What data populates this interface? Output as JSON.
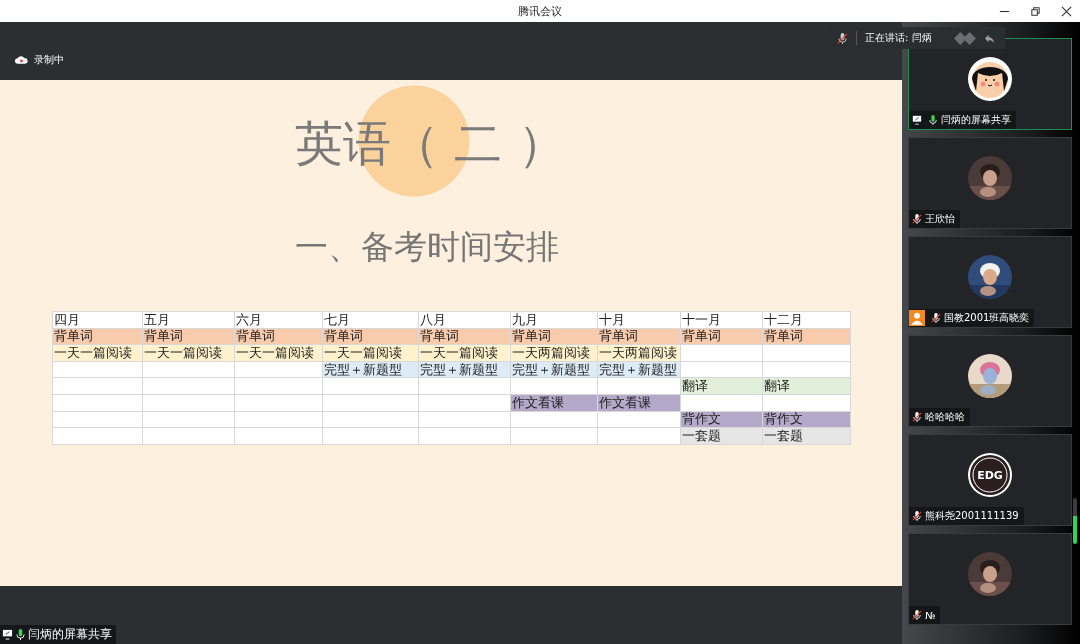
{
  "window": {
    "title": "腾讯会议"
  },
  "recording": {
    "label": "录制中"
  },
  "speaking": {
    "label": "正在讲话: 闫炳"
  },
  "slide": {
    "title": "英语（ 二 ）",
    "subtitle": "一、备考时间安排",
    "table": {
      "columns": [
        "四月",
        "五月",
        "六月",
        "七月",
        "八月",
        "九月",
        "十月",
        "十一月",
        "十二月"
      ],
      "rows": [
        [
          {
            "text": "背单词",
            "color": "#f8cbad"
          },
          {
            "text": "背单词",
            "color": "#f8cbad"
          },
          {
            "text": "背单词",
            "color": "#f8cbad"
          },
          {
            "text": "背单词",
            "color": "#f8cbad"
          },
          {
            "text": "背单词",
            "color": "#f8cbad"
          },
          {
            "text": "背单词",
            "color": "#f8cbad"
          },
          {
            "text": "背单词",
            "color": "#f8cbad"
          },
          {
            "text": "背单词",
            "color": "#f8cbad"
          },
          {
            "text": "背单词",
            "color": "#f8cbad"
          }
        ],
        [
          {
            "text": "一天一篇阅读",
            "color": "#fff2cc"
          },
          {
            "text": "一天一篇阅读",
            "color": "#fff2cc"
          },
          {
            "text": "一天一篇阅读",
            "color": "#fff2cc"
          },
          {
            "text": "一天一篇阅读",
            "color": "#fff2cc"
          },
          {
            "text": "一天一篇阅读",
            "color": "#fff2cc"
          },
          {
            "text": "一天两篇阅读",
            "color": "#fff2cc"
          },
          {
            "text": "一天两篇阅读",
            "color": "#fff2cc"
          },
          {},
          {}
        ],
        [
          {},
          {},
          {},
          {
            "text": "完型＋新题型",
            "color": "#ddebf7"
          },
          {
            "text": "完型＋新题型",
            "color": "#ddebf7"
          },
          {
            "text": "完型＋新题型",
            "color": "#ddebf7"
          },
          {
            "text": "完型＋新题型",
            "color": "#ddebf7"
          },
          {},
          {}
        ],
        [
          {},
          {},
          {},
          {},
          {},
          {},
          {},
          {
            "text": "翻译",
            "color": "#e2efda"
          },
          {
            "text": "翻译",
            "color": "#e2efda"
          }
        ],
        [
          {},
          {},
          {},
          {},
          {},
          {
            "text": "作文看课",
            "color": "#b4a9c8"
          },
          {
            "text": "作文看课",
            "color": "#b4a9c8"
          },
          {},
          {}
        ],
        [
          {},
          {},
          {},
          {},
          {},
          {},
          {},
          {
            "text": "背作文",
            "color": "#b4a9c8"
          },
          {
            "text": "背作文",
            "color": "#b4a9c8"
          }
        ],
        [
          {},
          {},
          {},
          {},
          {},
          {},
          {},
          {
            "text": "一套题",
            "color": "#e7e6e6"
          },
          {
            "text": "一套题",
            "color": "#e7e6e6"
          }
        ]
      ]
    }
  },
  "share_label": {
    "text": "闫炳的屏幕共享"
  },
  "participants": [
    {
      "name": "闫炳的屏幕共享",
      "kind": "cartoon",
      "muted": false,
      "sharing": true,
      "selected": true,
      "host": false
    },
    {
      "name": "王欣怡",
      "kind": "picture",
      "muted": true,
      "sharing": false,
      "selected": false,
      "host": false
    },
    {
      "name": "国教2001班高晓奕",
      "kind": "picture",
      "muted": true,
      "sharing": false,
      "selected": false,
      "host": true
    },
    {
      "name": "哈哈哈哈",
      "kind": "picture",
      "muted": true,
      "sharing": false,
      "selected": false,
      "host": false
    },
    {
      "name": "熊科尧2001111139",
      "kind": "logo",
      "logo_text": "EDG",
      "muted": true,
      "sharing": false,
      "selected": false,
      "host": false
    },
    {
      "name": "№",
      "kind": "picture",
      "muted": true,
      "sharing": false,
      "selected": false,
      "host": false
    }
  ]
}
